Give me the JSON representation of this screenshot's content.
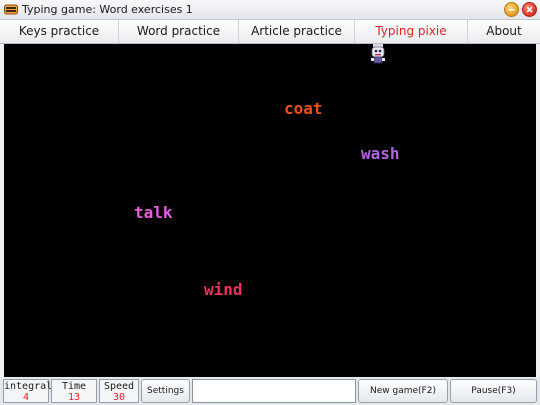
{
  "window": {
    "title": "Typing game: Word exercises 1"
  },
  "menu": {
    "items": [
      {
        "label": "Keys practice"
      },
      {
        "label": "Word practice"
      },
      {
        "label": "Article practice"
      },
      {
        "label": "Typing pixie",
        "active": true
      },
      {
        "label": "About"
      }
    ]
  },
  "game": {
    "background": "#000000",
    "words": [
      {
        "text": "coat",
        "color": "#e8501e"
      },
      {
        "text": "wash",
        "color": "#b065e0"
      },
      {
        "text": "talk",
        "color": "#e45fe0"
      },
      {
        "text": "wind",
        "color": "#f0305e"
      }
    ]
  },
  "status": {
    "integral_label": "integral",
    "integral_value": "4",
    "time_label": "Time",
    "time_value": "13",
    "speed_label": "Speed",
    "speed_value": "30",
    "settings_label": "Settings",
    "input_value": "",
    "new_game_label": "New game(F2)",
    "pause_label": "Pause(F3)"
  },
  "colors": {
    "accent_red": "#e0242a"
  }
}
